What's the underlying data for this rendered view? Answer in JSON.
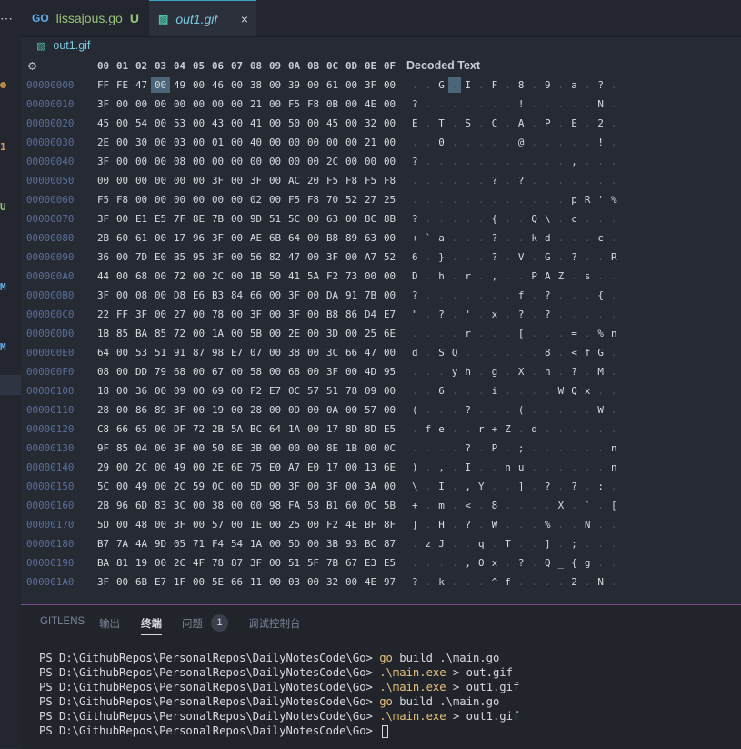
{
  "activity_bar": {
    "more_label": "⋯",
    "marks": [
      {
        "text": "1",
        "color": "#d19a66"
      },
      {
        "text": "U",
        "color": "#98c379"
      },
      {
        "text": "M",
        "color": "#61afef"
      },
      {
        "text": "M",
        "color": "#61afef"
      }
    ]
  },
  "tabs": [
    {
      "label": "lissajous.go",
      "icon": "go-file-icon",
      "icon_text": "GO",
      "status": "U",
      "active": false
    },
    {
      "label": "out1.gif",
      "icon": "image-file-icon",
      "icon_text": "▨",
      "close": "×",
      "active": true
    }
  ],
  "breadcrumb": {
    "icon": "image-file-icon",
    "icon_text": "▨",
    "label": "out1.gif"
  },
  "hex_editor": {
    "settings_icon": "⚙",
    "columns": [
      "00",
      "01",
      "02",
      "03",
      "04",
      "05",
      "06",
      "07",
      "08",
      "09",
      "0A",
      "0B",
      "0C",
      "0D",
      "0E",
      "0F"
    ],
    "decoded_header": "Decoded Text",
    "selected": {
      "row": 0,
      "col": 3
    },
    "rows": [
      {
        "offset": "00000000",
        "bytes": "FF FE 47 00 49 00 46 00 38 00 39 00 61 00 3F 00",
        "decoded": ". . G . I . F . 8 . 9 . a . ? ."
      },
      {
        "offset": "00000010",
        "bytes": "3F 00 00 00 00 00 00 00 21 00 F5 F8 0B 00 4E 00",
        "decoded": "? . . . . . . . ! . . . . . N ."
      },
      {
        "offset": "00000020",
        "bytes": "45 00 54 00 53 00 43 00 41 00 50 00 45 00 32 00",
        "decoded": "E . T . S . C . A . P . E . 2 ."
      },
      {
        "offset": "00000030",
        "bytes": "2E 00 30 00 03 00 01 00 40 00 00 00 00 00 21 00",
        "decoded": ". . 0 . . . . . @ . . . . . ! ."
      },
      {
        "offset": "00000040",
        "bytes": "3F 00 00 00 08 00 00 00 00 00 00 00 2C 00 00 00",
        "decoded": "? . . . . . . . . . . . , . . ."
      },
      {
        "offset": "00000050",
        "bytes": "00 00 00 00 00 00 3F 00 3F 00 AC 20 F5 F8 F5 F8",
        "decoded": ". . . . . . ? . ? . . . . . . ."
      },
      {
        "offset": "00000060",
        "bytes": "F5 F8 00 00 00 00 00 00 02 00 F5 F8 70 52 27 25",
        "decoded": ". . . . . . . . . . . . p R ' %"
      },
      {
        "offset": "00000070",
        "bytes": "3F 00 E1 E5 7F 8E 7B 00 9D 51 5C 00 63 00 8C 8B",
        "decoded": "? . . . . . { . . Q \\ . c . . ."
      },
      {
        "offset": "00000080",
        "bytes": "2B 60 61 00 17 96 3F 00 AE 6B 64 00 B8 89 63 00",
        "decoded": "+ ` a . . . ? . . k d . . . c ."
      },
      {
        "offset": "00000090",
        "bytes": "36 00 7D E0 B5 95 3F 00 56 82 47 00 3F 00 A7 52",
        "decoded": "6 . } . . . ? . V . G . ? . . R"
      },
      {
        "offset": "000000A0",
        "bytes": "44 00 68 00 72 00 2C 00 1B 50 41 5A F2 73 00 00",
        "decoded": "D . h . r . , . . P A Z . s . ."
      },
      {
        "offset": "000000B0",
        "bytes": "3F 00 08 00 D8 E6 B3 84 66 00 3F 00 DA 91 7B 00",
        "decoded": "? . . . . . . . f . ? . . . { ."
      },
      {
        "offset": "000000C0",
        "bytes": "22 FF 3F 00 27 00 78 00 3F 00 3F 00 B8 86 D4 E7",
        "decoded": "\" . ? . ' . x . ? . ? . . . . ."
      },
      {
        "offset": "000000D0",
        "bytes": "1B 85 BA 85 72 00 1A 00 5B 00 2E 00 3D 00 25 6E",
        "decoded": ". . . . r . . . [ . . . = . % n"
      },
      {
        "offset": "000000E0",
        "bytes": "64 00 53 51 91 87 98 E7 07 00 38 00 3C 66 47 00",
        "decoded": "d . S Q . . . . . . 8 . < f G ."
      },
      {
        "offset": "000000F0",
        "bytes": "08 00 DD 79 68 00 67 00 58 00 68 00 3F 00 4D 95",
        "decoded": ". . . y h . g . X . h . ? . M ."
      },
      {
        "offset": "00000100",
        "bytes": "18 00 36 00 09 00 69 00 F2 E7 0C 57 51 78 09 00",
        "decoded": ". . 6 . . . i . . . . W Q x . ."
      },
      {
        "offset": "00000110",
        "bytes": "28 00 86 89 3F 00 19 00 28 00 0D 00 0A 00 57 00",
        "decoded": "( . . . ? . . . ( . . . . . W ."
      },
      {
        "offset": "00000120",
        "bytes": "C8 66 65 00 DF 72 2B 5A BC 64 1A 00 17 8D 8D E5",
        "decoded": ". f e . . r + Z . d . . . . . ."
      },
      {
        "offset": "00000130",
        "bytes": "9F 85 04 00 3F 00 50 8E 3B 00 00 00 8E 1B 00 0C 6E",
        "decoded": ". . . . ? . P . ; . . . . . . n"
      },
      {
        "offset": "00000140",
        "bytes": "29 00 2C 00 49 00 2E 6E 75 E0 A7 E0 17 00 13 6E",
        "decoded": ") . , . I . . n u . . . . . . n"
      },
      {
        "offset": "00000150",
        "bytes": "5C 00 49 00 2C 59 0C 00 5D 00 3F 00 3F 00 3A 00",
        "decoded": "\\ . I . , Y . . ] . ? . ? . : ."
      },
      {
        "offset": "00000160",
        "bytes": "2B 96 6D 83 3C 00 38 00 00 98 FA 58 B1 60 0C 5B",
        "decoded": "+ . m . < . 8 . . . . X . ` . ["
      },
      {
        "offset": "00000170",
        "bytes": "5D 00 48 00 3F 00 57 00 1E 00 25 00 F2 4E BF 8F",
        "decoded": "] . H . ? . W . . . % . . N . ."
      },
      {
        "offset": "00000180",
        "bytes": "B7 7A 4A 9D 05 71 F4 54 1A 00 5D 00 3B 93 BC 87",
        "decoded": ". z J . . q . T . . ] . ; . . ."
      },
      {
        "offset": "00000190",
        "bytes": "BA 81 19 00 2C 4F 78 87 3F 00 51 5F 7B 67 E3 E5",
        "decoded": ". . . . , O x . ? . Q _ { g . ."
      },
      {
        "offset": "000001A0",
        "bytes": "3F 00 6B E7 1F 00 5E 66 11 00 03 00 32 00 4E 97",
        "decoded": "? . k . . . ^ f . . . . 2 . N ."
      }
    ]
  },
  "panel": {
    "tabs": [
      "GITLENS",
      "输出",
      "终端",
      "问题",
      "调试控制台"
    ],
    "active_tab": "终端",
    "problems_count": "1",
    "terminal": [
      {
        "prompt": "PS D:\\GithubRepos\\PersonalRepos\\DailyNotesCode\\Go>",
        "cmd": "go",
        "args": "build .\\main.go"
      },
      {
        "prompt": "PS D:\\GithubRepos\\PersonalRepos\\DailyNotesCode\\Go>",
        "cmd": ".\\main.exe",
        "args": "> out.gif"
      },
      {
        "prompt": "PS D:\\GithubRepos\\PersonalRepos\\DailyNotesCode\\Go>",
        "cmd": ".\\main.exe",
        "args": "> out1.gif"
      },
      {
        "prompt": "PS D:\\GithubRepos\\PersonalRepos\\DailyNotesCode\\Go>",
        "cmd": "go",
        "args": "build .\\main.go"
      },
      {
        "prompt": "PS D:\\GithubRepos\\PersonalRepos\\DailyNotesCode\\Go>",
        "cmd": ".\\main.exe",
        "args": "> out1.gif"
      },
      {
        "prompt": "PS D:\\GithubRepos\\PersonalRepos\\DailyNotesCode\\Go>",
        "cmd": "",
        "args": ""
      }
    ]
  }
}
